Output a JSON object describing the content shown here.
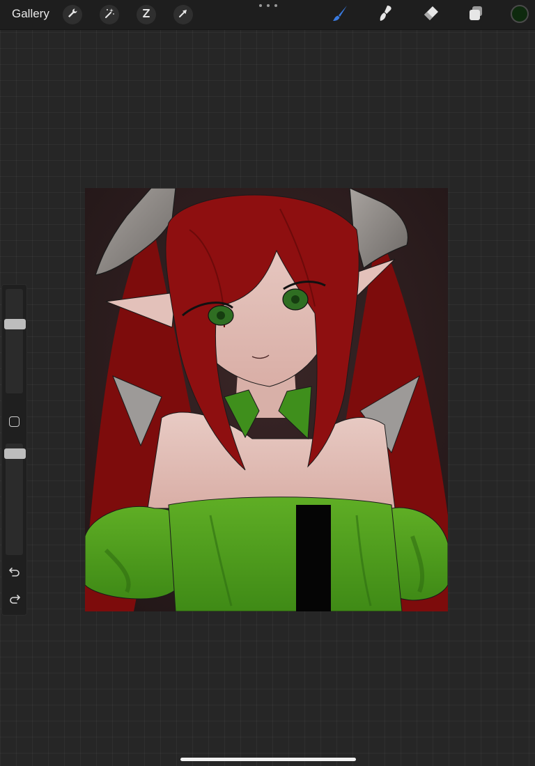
{
  "topbar": {
    "gallery_label": "Gallery",
    "left_tools": [
      {
        "name": "actions",
        "icon": "wrench-icon"
      },
      {
        "name": "adjustments",
        "icon": "magic-wand-icon"
      },
      {
        "name": "selection",
        "icon": "selection-s-icon"
      },
      {
        "name": "transform",
        "icon": "arrow-cursor-icon"
      }
    ],
    "right_tools": [
      {
        "name": "brush",
        "icon": "brush-icon",
        "active": true
      },
      {
        "name": "smudge",
        "icon": "smudge-icon"
      },
      {
        "name": "eraser",
        "icon": "eraser-icon"
      },
      {
        "name": "layers",
        "icon": "layers-icon"
      }
    ],
    "current_color": "#0e2a0e",
    "accent_color": "#3a7be0"
  },
  "sidebar": {
    "brush_size_level": 0.68,
    "opacity_level": 0.95,
    "modifier_icon": "square-modifier-icon",
    "undo_icon": "undo-icon",
    "redo_icon": "redo-icon"
  },
  "canvas": {
    "artwork": "red-haired-horned-character-illustration"
  }
}
